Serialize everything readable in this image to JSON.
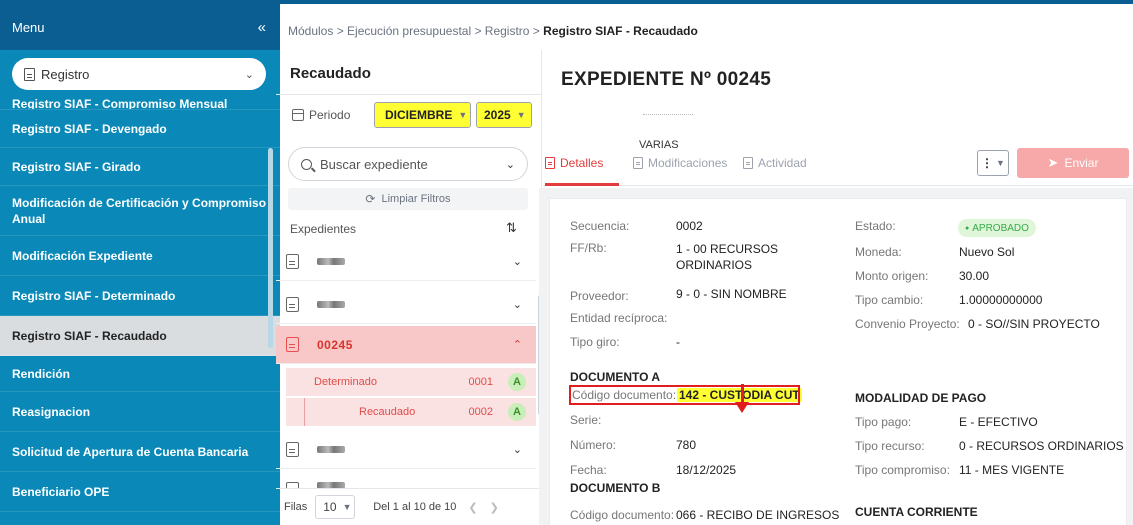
{
  "sidebar": {
    "title": "Menu",
    "collapse_icon": "«",
    "module_select": "Registro",
    "items": [
      {
        "label": "Registro SIAF - Compromiso Mensual",
        "active": false
      },
      {
        "label": "Registro SIAF - Devengado",
        "active": false
      },
      {
        "label": "Registro SIAF - Girado",
        "active": false
      },
      {
        "label": "Modificación de Certificación y Compromiso Anual",
        "active": false
      },
      {
        "label": "Modificación Expediente",
        "active": false
      },
      {
        "label": "Registro SIAF - Determinado",
        "active": false
      },
      {
        "label": "Registro SIAF - Recaudado",
        "active": true
      },
      {
        "label": "Rendición",
        "active": false
      },
      {
        "label": "Reasignacion",
        "active": false
      },
      {
        "label": "Solicitud de Apertura de Cuenta Bancaria",
        "active": false
      },
      {
        "label": "Beneficiario OPE",
        "active": false
      }
    ]
  },
  "breadcrumb": {
    "path": "Módulos > Ejecución presupuestal > Registro > ",
    "current": "Registro SIAF - Recaudado"
  },
  "list_panel": {
    "title": "Recaudado",
    "period_label": "Periodo",
    "month": "DICIEMBRE",
    "year": "2025",
    "search_placeholder": "Buscar expediente",
    "clear_filters": "Limpiar Filtros",
    "expedientes_label": "Expedientes",
    "active_expediente": "00245",
    "sub_items": [
      {
        "label": "Determinado",
        "number": "0001",
        "badge": "A"
      },
      {
        "label": "Recaudado",
        "number": "0002",
        "badge": "A"
      }
    ],
    "pager": {
      "rows_label": "Filas",
      "page_size": "10",
      "range": "Del 1 al 10 de 10"
    }
  },
  "detail": {
    "title": "EXPEDIENTE Nº 00245",
    "header_value": "VARIAS",
    "tabs": [
      "Detalles",
      "Modificaciones",
      "Actividad"
    ],
    "send_label": "Enviar",
    "fields_left": [
      {
        "label": "Secuencia:",
        "value": "0002"
      },
      {
        "label": "FF/Rb:",
        "value": "1 - 00 RECURSOS ORDINARIOS"
      },
      {
        "label": "Proveedor:",
        "value": "9 - 0 - SIN NOMBRE"
      },
      {
        "label": "Entidad recíproca:",
        "value": ""
      },
      {
        "label": "Tipo giro:",
        "value": "-"
      }
    ],
    "fields_right": [
      {
        "label": "Estado:",
        "value": "APROBADO"
      },
      {
        "label": "Moneda:",
        "value": "Nuevo Sol"
      },
      {
        "label": "Monto origen:",
        "value": "30.00"
      },
      {
        "label": "Tipo cambio:",
        "value": "1.00000000000"
      },
      {
        "label": "Convenio Proyecto:",
        "value": "0 - SO//SIN PROYECTO"
      }
    ],
    "documento_a": {
      "title": "DOCUMENTO A",
      "fields": [
        {
          "label": "Código documento:",
          "value": "142 - CUSTODIA CUT"
        },
        {
          "label": "Serie:",
          "value": ""
        },
        {
          "label": "Número:",
          "value": "780"
        },
        {
          "label": "Fecha:",
          "value": "18/12/2025"
        }
      ]
    },
    "modalidad_pago": {
      "title": "MODALIDAD DE PAGO",
      "fields": [
        {
          "label": "Tipo pago:",
          "value": "E - EFECTIVO"
        },
        {
          "label": "Tipo recurso:",
          "value": "0 - RECURSOS ORDINARIOS"
        },
        {
          "label": "Tipo compromiso:",
          "value": "11 - MES VIGENTE"
        }
      ]
    },
    "documento_b": {
      "title": "DOCUMENTO B",
      "fields": [
        {
          "label": "Código documento:",
          "value": "066 - RECIBO DE INGRESOS"
        }
      ]
    },
    "cuenta_corriente_title": "CUENTA CORRIENTE"
  },
  "colors": {
    "sidebar_bg": "#0a89b8",
    "sidebar_header": "#0a5e92",
    "highlight_yellow": "#ffff33",
    "accent_red": "#e23c3c",
    "approved_green": "#3aa94a"
  }
}
